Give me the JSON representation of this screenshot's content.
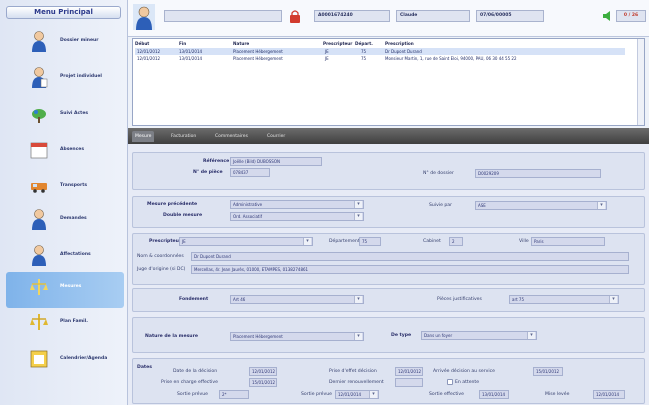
{
  "sidebar": {
    "title": "Menu Principal",
    "items": [
      {
        "label": "Dossier mineur",
        "icon": "person-icon"
      },
      {
        "label": "Projet individuel",
        "icon": "person-document-icon"
      },
      {
        "label": "Suivi Actes",
        "icon": "leaf-icon"
      },
      {
        "label": "Absences",
        "icon": "calendar-icon"
      },
      {
        "label": "Transports",
        "icon": "vehicle-icon"
      },
      {
        "label": "Demandes",
        "icon": "person-question-icon"
      },
      {
        "label": "Affectations",
        "icon": "person-assign-icon"
      },
      {
        "label": "Mesures",
        "icon": "scale-icon"
      },
      {
        "label": "Plan Famil.",
        "icon": "scale-family-icon"
      },
      {
        "label": "Calendrier/Agenda",
        "icon": "agenda-icon"
      }
    ]
  },
  "header": {
    "name_field": "",
    "id_field": "A0001674240",
    "first_name": "Claude",
    "number": "07/06/00005",
    "status_value": "0 / 26"
  },
  "measures_table": {
    "headers": [
      "Début",
      "Fin",
      "Nature",
      "Prescripteur",
      "Départ.",
      "Prescription"
    ],
    "rows": [
      [
        "12/01/2012",
        "13/01/2014",
        "Placement Hébergement",
        "JE",
        "75",
        "Dr Dupont Durand"
      ],
      [
        "12/01/2012",
        "13/01/2014",
        "Placement Hébergement",
        "JE",
        "75",
        "Monsieur Martin, 1, rue de Saint Eloi, 94000, PAU, 06 30 44 55 22"
      ]
    ]
  },
  "tabs": [
    "Mesure",
    "Facturation",
    "Commentaires",
    "Courrier"
  ],
  "form": {
    "reference_label": "Référence",
    "reference_value": "Joëlle (Bild) DUBOSSON",
    "piece_no_label": "N° de pièce",
    "piece_no_value": "078437",
    "dossier_no_label": "N° de dossier",
    "dossier_no_value": "D0029209",
    "prev_measure_label": "Mesure précédente",
    "prev_measure_value": "Administrative",
    "double_measure_label": "Double mesure",
    "double_measure_value": "Ord. Associatif",
    "followed_by_label": "Suivie par",
    "followed_by_value": "ASE",
    "prescriber_label": "Prescripteur",
    "prescriber_value": "JE",
    "department_label": "Département",
    "department_value": "75",
    "cabinet_label": "Cabinet",
    "cabinet_value": "2",
    "city_label": "Ville",
    "city_value": "Paris",
    "name_coords_label": "Nom & coordonnées",
    "name_coords_value": "Dr Dupont Durand",
    "judge_label": "Juge d'origine (si DC)",
    "judge_value": "Mercellas, 4r. Jean Jaurès, 01000, ETAMPES, 0138274861",
    "basis_label": "Fondement",
    "basis_value": "Art 46",
    "supporting_label": "Pièces justificatives",
    "supporting_value": "art 75",
    "nature_label": "Nature de la mesure",
    "nature_value": "Placement Hébergement",
    "type_label": "De type",
    "type_value": "Dans un foyer",
    "dates_title": "Dates",
    "decision_date_label": "Date de la décision",
    "decision_date_value": "12/01/2012",
    "effect_label": "Prise d'effet décision",
    "effect_value": "12/01/2012",
    "arrival_label": "Arrivée décision au service",
    "arrival_value": "15/01/2012",
    "takeover_label": "Prise en charge effective",
    "takeover_value": "15/01/2012",
    "renewal_label": "Dernier renouvellement",
    "renewal_value": "",
    "pending_label": "En attente",
    "planned_exit_label": "Sortie prévue",
    "planned_exit_value": "2*",
    "exit_label": "Sortie prévue",
    "exit_value": "12/01/2014",
    "effective_exit_label": "Sortie effective",
    "effective_exit_value": "13/01/2014",
    "raised_label": "Mise levée",
    "raised_value": "12/01/2014"
  }
}
